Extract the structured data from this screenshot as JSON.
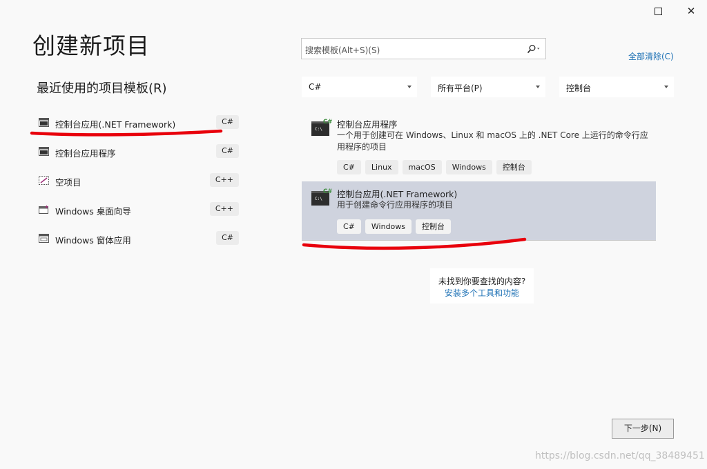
{
  "window": {
    "maximize_icon": "maximize-icon",
    "close_icon": "close-icon",
    "close_glyph": "✕"
  },
  "page_title": "创建新项目",
  "recent": {
    "title": "最近使用的项目模板(R)",
    "items": [
      {
        "label": "控制台应用(.NET Framework)",
        "lang": "C#",
        "icon": "console-app-icon"
      },
      {
        "label": "控制台应用程序",
        "lang": "C#",
        "icon": "console-app-icon"
      },
      {
        "label": "空项目",
        "lang": "C++",
        "icon": "empty-project-icon"
      },
      {
        "label": "Windows 桌面向导",
        "lang": "C++",
        "icon": "desktop-wizard-icon"
      },
      {
        "label": "Windows 窗体应用",
        "lang": "C#",
        "icon": "windows-forms-icon"
      }
    ]
  },
  "search": {
    "placeholder": "搜索模板(Alt+S)(S)",
    "icon": "search-icon"
  },
  "clear_all": "全部清除(C)",
  "filters": {
    "language": "C#",
    "platform": "所有平台(P)",
    "project_type": "控制台"
  },
  "templates": [
    {
      "title": "控制台应用程序",
      "description": "一个用于创建可在 Windows、Linux 和 macOS 上的 .NET Core 上运行的命令行应用程序的项目",
      "tags": [
        "C#",
        "Linux",
        "macOS",
        "Windows",
        "控制台"
      ],
      "selected": false
    },
    {
      "title": "控制台应用(.NET Framework)",
      "description": "用于创建命令行应用程序的项目",
      "tags": [
        "C#",
        "Windows",
        "控制台"
      ],
      "selected": true
    }
  ],
  "not_found": {
    "question": "未找到你要查找的内容?",
    "link": "安装多个工具和功能"
  },
  "next_button": "下一步(N)",
  "watermark": "https://blog.csdn.net/qq_38489451",
  "colors": {
    "accent_link": "#1a6fb4",
    "selected_row": "#cfd3de",
    "annotation": "#e8000b",
    "csharp_green": "#3c8c3c"
  }
}
